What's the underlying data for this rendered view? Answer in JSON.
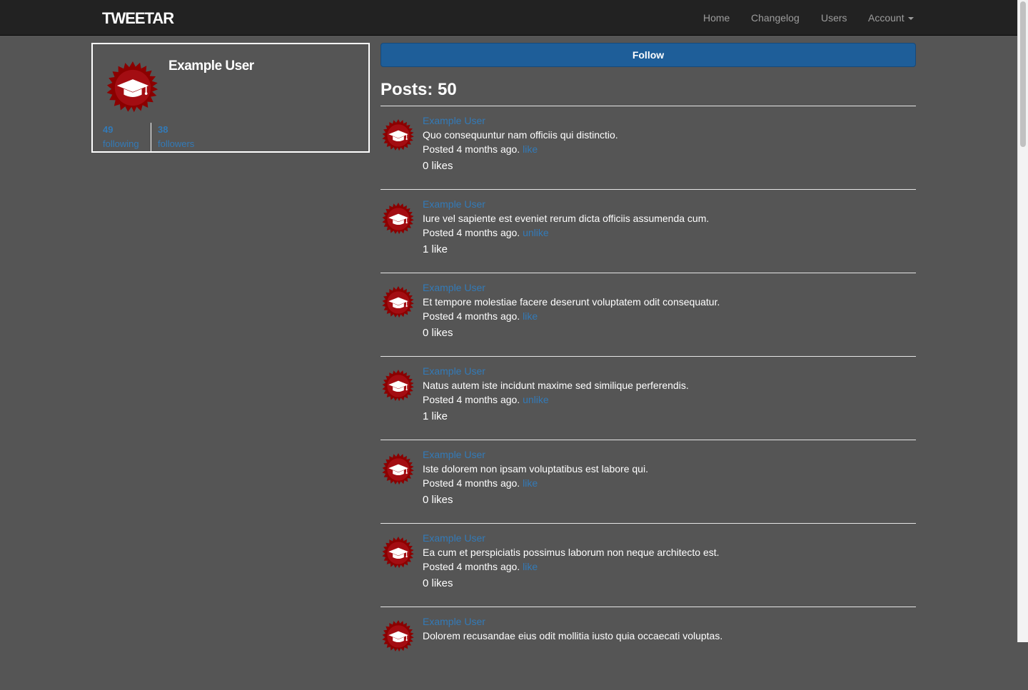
{
  "navbar": {
    "brand": "TWEETAR",
    "links": [
      {
        "label": "Home"
      },
      {
        "label": "Changelog"
      },
      {
        "label": "Users"
      },
      {
        "label": "Account"
      }
    ]
  },
  "profile": {
    "name": "Example User",
    "avatar_icon": "graduation-cap-badge",
    "following_count": "49",
    "following_label": "following",
    "followers_count": "38",
    "followers_label": "followers"
  },
  "follow_button": "Follow",
  "posts_heading": "Posts: 50",
  "posts": [
    {
      "user": "Example User",
      "content": "Quo consequuntur nam officiis qui distinctio.",
      "posted": "Posted 4 months ago.",
      "action": "like",
      "likes": "0 likes"
    },
    {
      "user": "Example User",
      "content": "Iure vel sapiente est eveniet rerum dicta officiis assumenda cum.",
      "posted": "Posted 4 months ago.",
      "action": "unlike",
      "likes": "1 like"
    },
    {
      "user": "Example User",
      "content": "Et tempore molestiae facere deserunt voluptatem odit consequatur.",
      "posted": "Posted 4 months ago.",
      "action": "like",
      "likes": "0 likes"
    },
    {
      "user": "Example User",
      "content": "Natus autem iste incidunt maxime sed similique perferendis.",
      "posted": "Posted 4 months ago.",
      "action": "unlike",
      "likes": "1 like"
    },
    {
      "user": "Example User",
      "content": "Iste dolorem non ipsam voluptatibus est labore qui.",
      "posted": "Posted 4 months ago.",
      "action": "like",
      "likes": "0 likes"
    },
    {
      "user": "Example User",
      "content": "Ea cum et perspiciatis possimus laborum non neque architecto est.",
      "posted": "Posted 4 months ago.",
      "action": "like",
      "likes": "0 likes"
    },
    {
      "user": "Example User",
      "content": "Dolorem recusandae eius odit mollitia iusto quia occaecati voluptas.",
      "posted": "",
      "action": "",
      "likes": ""
    }
  ],
  "colors": {
    "background": "#555555",
    "navbar": "#222222",
    "link": "#337ab7",
    "button": "#1e5e99",
    "badge": "#8b0000"
  }
}
